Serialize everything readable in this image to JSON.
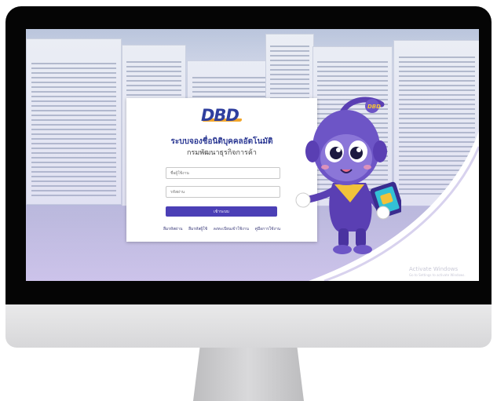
{
  "login": {
    "logo_text": "DBD",
    "title": "ระบบจองชื่อนิติบุคคลอัตโนมัติ",
    "subtitle": "กรมพัฒนาธุรกิจการค้า",
    "username_placeholder": "ชื่อผู้ใช้งาน",
    "password_placeholder": "รหัสผ่าน",
    "login_button": "เข้าระบบ"
  },
  "links": [
    "ลืมรหัสผ่าน",
    "ลืมรหัสผู้ใช้",
    "ลงทะเบียนเข้าใช้งาน",
    "คู่มือการใช้งาน"
  ],
  "watermark": {
    "title": "Activate Windows",
    "subtitle": "Go to Settings to activate Windows."
  },
  "colors": {
    "brand": "#2f3f9e",
    "accent": "#f2a62a",
    "button": "#4b3fb6",
    "mascot": "#5a3fb3"
  }
}
